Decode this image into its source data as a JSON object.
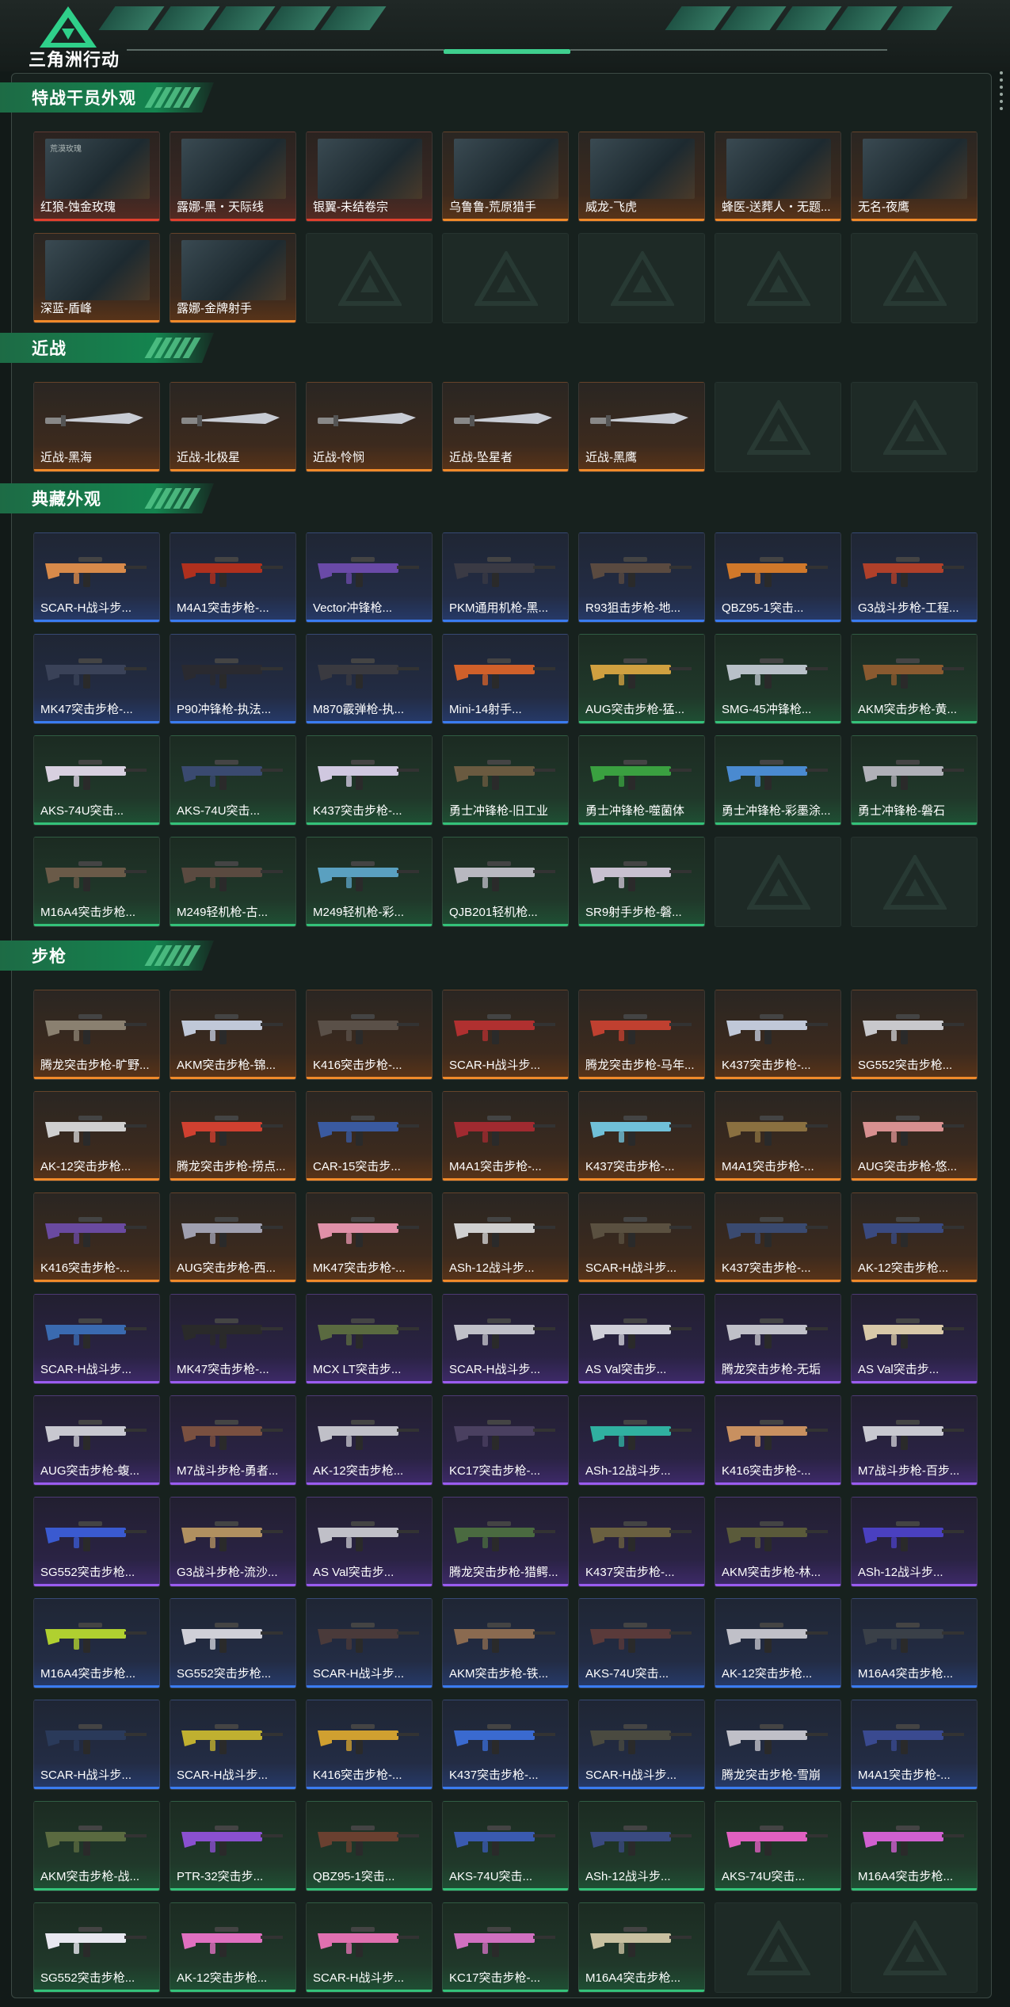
{
  "header": {
    "logo_text": "三角洲行动"
  },
  "colors": {
    "accent": "#3fcf8e",
    "section_green": "#14844f",
    "rarity_red": "#e0402e",
    "rarity_orange": "#f08a2a",
    "rarity_blue": "#3a7cf0",
    "rarity_green": "#34c27a",
    "rarity_purple": "#9a5cf0"
  },
  "sections": [
    {
      "title": "特战干员外观",
      "kind": "operator",
      "items": [
        {
          "name": "红狼-蚀金玫瑰",
          "rarity": "red",
          "tag": "荒漠玫瑰"
        },
        {
          "name": "露娜-黑・天际线",
          "rarity": "red",
          "tag": ""
        },
        {
          "name": "银翼-未结卷宗",
          "rarity": "red",
          "tag": ""
        },
        {
          "name": "乌鲁鲁-荒原猎手",
          "rarity": "orange",
          "tag": ""
        },
        {
          "name": "威龙-飞虎",
          "rarity": "orange",
          "tag": ""
        },
        {
          "name": "蜂医-送葬人・无题...",
          "rarity": "orange",
          "tag": ""
        },
        {
          "name": "无名-夜鹰",
          "rarity": "orange",
          "tag": ""
        },
        {
          "name": "深蓝-盾峰",
          "rarity": "orange",
          "tag": ""
        },
        {
          "name": "露娜-金牌射手",
          "rarity": "orange",
          "tag": ""
        },
        {
          "empty": true
        },
        {
          "empty": true
        },
        {
          "empty": true
        },
        {
          "empty": true
        },
        {
          "empty": true
        }
      ]
    },
    {
      "title": "近战",
      "kind": "melee",
      "items": [
        {
          "name": "近战-黑海",
          "rarity": "orange"
        },
        {
          "name": "近战-北极星",
          "rarity": "orange"
        },
        {
          "name": "近战-怜悯",
          "rarity": "orange"
        },
        {
          "name": "近战-坠星者",
          "rarity": "orange"
        },
        {
          "name": "近战-黑鹰",
          "rarity": "orange"
        },
        {
          "empty": true
        },
        {
          "empty": true
        }
      ]
    },
    {
      "title": "典藏外观",
      "kind": "gun",
      "items": [
        {
          "name": "SCAR-H战斗步...",
          "rarity": "blue",
          "color": "#d88a4a"
        },
        {
          "name": "M4A1突击步枪-...",
          "rarity": "blue",
          "color": "#b0301e"
        },
        {
          "name": "Vector冲锋枪...",
          "rarity": "blue",
          "color": "#6a4aa8"
        },
        {
          "name": "PKM通用机枪-黑...",
          "rarity": "blue",
          "color": "#3a3a44"
        },
        {
          "name": "R93狙击步枪-地...",
          "rarity": "blue",
          "color": "#5a4a40"
        },
        {
          "name": "QBZ95-1突击...",
          "rarity": "blue",
          "color": "#d0782a"
        },
        {
          "name": "G3战斗步枪-工程...",
          "rarity": "blue",
          "color": "#b0402a"
        },
        {
          "name": "MK47突击步枪-...",
          "rarity": "blue",
          "color": "#3a4258"
        },
        {
          "name": "P90冲锋枪-执法...",
          "rarity": "blue",
          "color": "#2a2a30"
        },
        {
          "name": "M870霰弹枪-执...",
          "rarity": "blue",
          "color": "#3a3a40"
        },
        {
          "name": "Mini-14射手...",
          "rarity": "blue",
          "color": "#d0602a"
        },
        {
          "name": "AUG突击步枪-猛...",
          "rarity": "green",
          "color": "#d0a040"
        },
        {
          "name": "SMG-45冲锋枪...",
          "rarity": "green",
          "color": "#b8c0c8"
        },
        {
          "name": "AKM突击步枪-黄...",
          "rarity": "green",
          "color": "#8a5a30"
        },
        {
          "name": "AKS-74U突击...",
          "rarity": "green",
          "color": "#d8d0e0"
        },
        {
          "name": "AKS-74U突击...",
          "rarity": "green",
          "color": "#3a4a70"
        },
        {
          "name": "K437突击步枪-...",
          "rarity": "green",
          "color": "#d0c8e0"
        },
        {
          "name": "勇士冲锋枪-旧工业",
          "rarity": "green",
          "color": "#6a5a40"
        },
        {
          "name": "勇士冲锋枪-噬菌体",
          "rarity": "green",
          "color": "#3aa040"
        },
        {
          "name": "勇士冲锋枪-彩墨涂...",
          "rarity": "green",
          "color": "#4a8ad0"
        },
        {
          "name": "勇士冲锋枪-磐石",
          "rarity": "green",
          "color": "#b0b0b8"
        },
        {
          "name": "M16A4突击步枪...",
          "rarity": "green",
          "color": "#6a5a48"
        },
        {
          "name": "M249轻机枪-古...",
          "rarity": "green",
          "color": "#5a4a40"
        },
        {
          "name": "M249轻机枪-彩...",
          "rarity": "green",
          "color": "#5aa0c0"
        },
        {
          "name": "QJB201轻机枪...",
          "rarity": "green",
          "color": "#b8b8c0"
        },
        {
          "name": "SR9射手步枪-磐...",
          "rarity": "green",
          "color": "#c8c0d0"
        },
        {
          "empty": true
        },
        {
          "empty": true
        }
      ]
    },
    {
      "title": "步枪",
      "kind": "gun",
      "items": [
        {
          "name": "腾龙突击步枪-旷野...",
          "rarity": "orange",
          "color": "#8a8070"
        },
        {
          "name": "AKM突击步枪-锦...",
          "rarity": "orange",
          "color": "#c0c8d8"
        },
        {
          "name": "K416突击步枪-...",
          "rarity": "orange",
          "color": "#5a5048"
        },
        {
          "name": "SCAR-H战斗步...",
          "rarity": "orange",
          "color": "#b03030"
        },
        {
          "name": "腾龙突击步枪-马年...",
          "rarity": "orange",
          "color": "#c04030"
        },
        {
          "name": "K437突击步枪-...",
          "rarity": "orange",
          "color": "#c0c8d8"
        },
        {
          "name": "SG552突击步枪...",
          "rarity": "orange",
          "color": "#c8c8cc"
        },
        {
          "name": "AK-12突击步枪...",
          "rarity": "orange",
          "color": "#d0d0d0"
        },
        {
          "name": "腾龙突击步枪-捞点...",
          "rarity": "orange",
          "color": "#d04030"
        },
        {
          "name": "CAR-15突击步...",
          "rarity": "orange",
          "color": "#3a5aa0"
        },
        {
          "name": "M4A1突击步枪-...",
          "rarity": "orange",
          "color": "#a02a30"
        },
        {
          "name": "K437突击步枪-...",
          "rarity": "orange",
          "color": "#70c0d8"
        },
        {
          "name": "M4A1突击步枪-...",
          "rarity": "orange",
          "color": "#8a7040"
        },
        {
          "name": "AUG突击步枪-悠...",
          "rarity": "orange",
          "color": "#d89090"
        },
        {
          "name": "K416突击步枪-...",
          "rarity": "orange",
          "color": "#6a4aa0"
        },
        {
          "name": "AUG突击步枪-西...",
          "rarity": "orange",
          "color": "#a0a0b0"
        },
        {
          "name": "MK47突击步枪-...",
          "rarity": "orange",
          "color": "#e090a8"
        },
        {
          "name": "ASh-12战斗步...",
          "rarity": "orange",
          "color": "#d0d0d0"
        },
        {
          "name": "SCAR-H战斗步...",
          "rarity": "orange",
          "color": "#5a5040"
        },
        {
          "name": "K437突击步枪-...",
          "rarity": "orange",
          "color": "#3a4a70"
        },
        {
          "name": "AK-12突击步枪...",
          "rarity": "orange",
          "color": "#3a4a80"
        },
        {
          "name": "SCAR-H战斗步...",
          "rarity": "purple",
          "color": "#3a6ab0"
        },
        {
          "name": "MK47突击步枪-...",
          "rarity": "purple",
          "color": "#2a2a2a"
        },
        {
          "name": "MCX LT突击步...",
          "rarity": "purple",
          "color": "#5a6a40"
        },
        {
          "name": "SCAR-H战斗步...",
          "rarity": "purple",
          "color": "#c0c0c8"
        },
        {
          "name": "AS Val突击步...",
          "rarity": "purple",
          "color": "#d0d0d8"
        },
        {
          "name": "腾龙突击步枪-无垢",
          "rarity": "purple",
          "color": "#c0c0c8"
        },
        {
          "name": "AS Val突击步...",
          "rarity": "purple",
          "color": "#d8c8a8"
        },
        {
          "name": "AUG突击步枪-蝮...",
          "rarity": "purple",
          "color": "#c8c8d0"
        },
        {
          "name": "M7战斗步枪-勇者...",
          "rarity": "purple",
          "color": "#7a5040"
        },
        {
          "name": "AK-12突击步枪...",
          "rarity": "purple",
          "color": "#c0c0c8"
        },
        {
          "name": "KC17突击步枪-...",
          "rarity": "purple",
          "color": "#4a4060"
        },
        {
          "name": "ASh-12战斗步...",
          "rarity": "purple",
          "color": "#30b0a0"
        },
        {
          "name": "K416突击步枪-...",
          "rarity": "purple",
          "color": "#c89060"
        },
        {
          "name": "M7战斗步枪-百步...",
          "rarity": "purple",
          "color": "#c8c8d0"
        },
        {
          "name": "SG552突击步枪...",
          "rarity": "purple",
          "color": "#3a5ad0"
        },
        {
          "name": "G3战斗步枪-流沙...",
          "rarity": "purple",
          "color": "#b09060"
        },
        {
          "name": "AS Val突击步...",
          "rarity": "purple",
          "color": "#c0c0c8"
        },
        {
          "name": "腾龙突击步枪-猎鳄...",
          "rarity": "purple",
          "color": "#4a6a40"
        },
        {
          "name": "K437突击步枪-...",
          "rarity": "purple",
          "color": "#6a6040"
        },
        {
          "name": "AKM突击步枪-林...",
          "rarity": "purple",
          "color": "#5a5a3a"
        },
        {
          "name": "ASh-12战斗步...",
          "rarity": "purple",
          "color": "#4a40c0"
        },
        {
          "name": "M16A4突击步枪...",
          "rarity": "blue",
          "color": "#b0d030"
        },
        {
          "name": "SG552突击步枪...",
          "rarity": "blue",
          "color": "#d0d0d8"
        },
        {
          "name": "SCAR-H战斗步...",
          "rarity": "blue",
          "color": "#4a3a3a"
        },
        {
          "name": "AKM突击步枪-铁...",
          "rarity": "blue",
          "color": "#8a6a50"
        },
        {
          "name": "AKS-74U突击...",
          "rarity": "blue",
          "color": "#5a3a3a"
        },
        {
          "name": "AK-12突击步枪...",
          "rarity": "blue",
          "color": "#c0c0c8"
        },
        {
          "name": "M16A4突击步枪...",
          "rarity": "blue",
          "color": "#3a4048"
        },
        {
          "name": "SCAR-H战斗步...",
          "rarity": "blue",
          "color": "#2a3a5a"
        },
        {
          "name": "SCAR-H战斗步...",
          "rarity": "blue",
          "color": "#c0b030"
        },
        {
          "name": "K416突击步枪-...",
          "rarity": "blue",
          "color": "#d0a030"
        },
        {
          "name": "K437突击步枪-...",
          "rarity": "blue",
          "color": "#3a6ad0"
        },
        {
          "name": "SCAR-H战斗步...",
          "rarity": "blue",
          "color": "#4a4a40"
        },
        {
          "name": "腾龙突击步枪-雪崩",
          "rarity": "blue",
          "color": "#c0c0c8"
        },
        {
          "name": "M4A1突击步枪-...",
          "rarity": "blue",
          "color": "#3a4a90"
        },
        {
          "name": "AKM突击步枪-战...",
          "rarity": "green",
          "color": "#5a6a40"
        },
        {
          "name": "PTR-32突击步...",
          "rarity": "green",
          "color": "#8a50d0"
        },
        {
          "name": "QBZ95-1突击...",
          "rarity": "green",
          "color": "#6a4030"
        },
        {
          "name": "AKS-74U突击...",
          "rarity": "green",
          "color": "#3a5ab0"
        },
        {
          "name": "ASh-12战斗步...",
          "rarity": "green",
          "color": "#3a4a80"
        },
        {
          "name": "AKS-74U突击...",
          "rarity": "green",
          "color": "#e060c0"
        },
        {
          "name": "M16A4突击步枪...",
          "rarity": "green",
          "color": "#d060d0"
        },
        {
          "name": "SG552突击步枪...",
          "rarity": "green",
          "color": "#e8e8f0"
        },
        {
          "name": "AK-12突击步枪...",
          "rarity": "green",
          "color": "#e070c0"
        },
        {
          "name": "SCAR-H战斗步...",
          "rarity": "green",
          "color": "#e070b0"
        },
        {
          "name": "KC17突击步枪-...",
          "rarity": "green",
          "color": "#d070c0"
        },
        {
          "name": "M16A4突击步枪...",
          "rarity": "green",
          "color": "#c8c0a0"
        },
        {
          "empty": true
        },
        {
          "empty": true
        }
      ]
    }
  ]
}
